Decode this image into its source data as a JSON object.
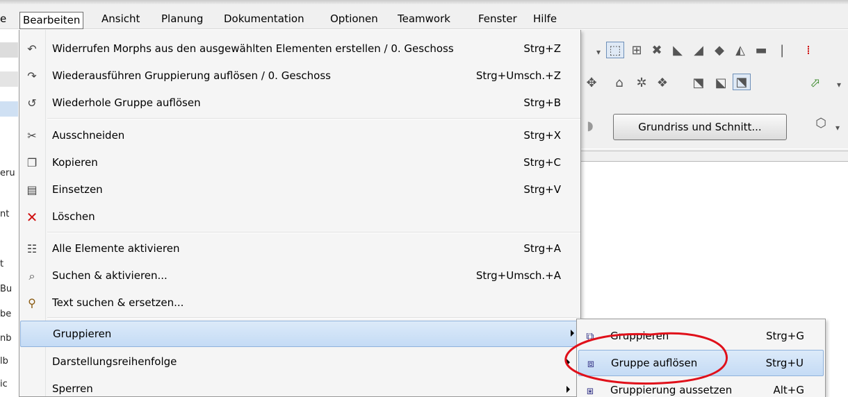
{
  "menubar": {
    "items": [
      {
        "label": "e"
      },
      {
        "label": "Bearbeiten",
        "active": true
      },
      {
        "label": "Ansicht"
      },
      {
        "label": "Planung"
      },
      {
        "label": "Dokumentation"
      },
      {
        "label": "Optionen"
      },
      {
        "label": "Teamwork"
      },
      {
        "label": "Fenster"
      },
      {
        "label": "Hilfe"
      }
    ]
  },
  "left_strip": [
    "eru",
    "nt",
    "t",
    "Bu",
    "be",
    "nb",
    "lb",
    "ic"
  ],
  "toolbar": {
    "button_label": "Grundriss und Schnitt..."
  },
  "edit_menu": {
    "items": [
      {
        "icon": "undo-icon",
        "label": "Widerrufen Morphs aus den ausgewählten Elementen erstellen / 0. Geschoss",
        "shortcut": "Strg+Z"
      },
      {
        "icon": "redo-icon",
        "label": "Wiederausführen Gruppierung auflösen / 0. Geschoss",
        "shortcut": "Strg+Umsch.+Z"
      },
      {
        "icon": "repeat-icon",
        "label": "Wiederhole Gruppe auflösen",
        "shortcut": "Strg+B"
      },
      {
        "icon": "scissors-icon",
        "label": "Ausschneiden",
        "shortcut": "Strg+X"
      },
      {
        "icon": "copy-icon",
        "label": "Kopieren",
        "shortcut": "Strg+C"
      },
      {
        "icon": "paste-icon",
        "label": "Einsetzen",
        "shortcut": "Strg+V"
      },
      {
        "icon": "delete-icon",
        "label": "Löschen",
        "shortcut": ""
      },
      {
        "icon": "select-all-icon",
        "label": "Alle Elemente aktivieren",
        "shortcut": "Strg+A"
      },
      {
        "icon": "find-select-icon",
        "label": "Suchen & aktivieren...",
        "shortcut": "Strg+Umsch.+A"
      },
      {
        "icon": "find-replace-text-icon",
        "label": "Text suchen & ersetzen...",
        "shortcut": ""
      },
      {
        "icon": "",
        "label": "Gruppieren",
        "shortcut": "",
        "submenu": true,
        "highlighted": true
      },
      {
        "icon": "",
        "label": "Darstellungsreihenfolge",
        "shortcut": "",
        "submenu": true
      },
      {
        "icon": "",
        "label": "Sperren",
        "shortcut": "",
        "submenu": true
      }
    ]
  },
  "group_submenu": {
    "items": [
      {
        "icon": "group-icon",
        "label": "Gruppieren",
        "shortcut": "Strg+G"
      },
      {
        "icon": "ungroup-icon",
        "label": "Gruppe auflösen",
        "shortcut": "Strg+U",
        "highlighted": true
      },
      {
        "icon": "suspend-group-icon",
        "label": "Gruppierung aussetzen",
        "shortcut": "Alt+G"
      }
    ]
  },
  "annotation": {
    "color": "#e0101a",
    "target": "Gruppe auflösen"
  }
}
